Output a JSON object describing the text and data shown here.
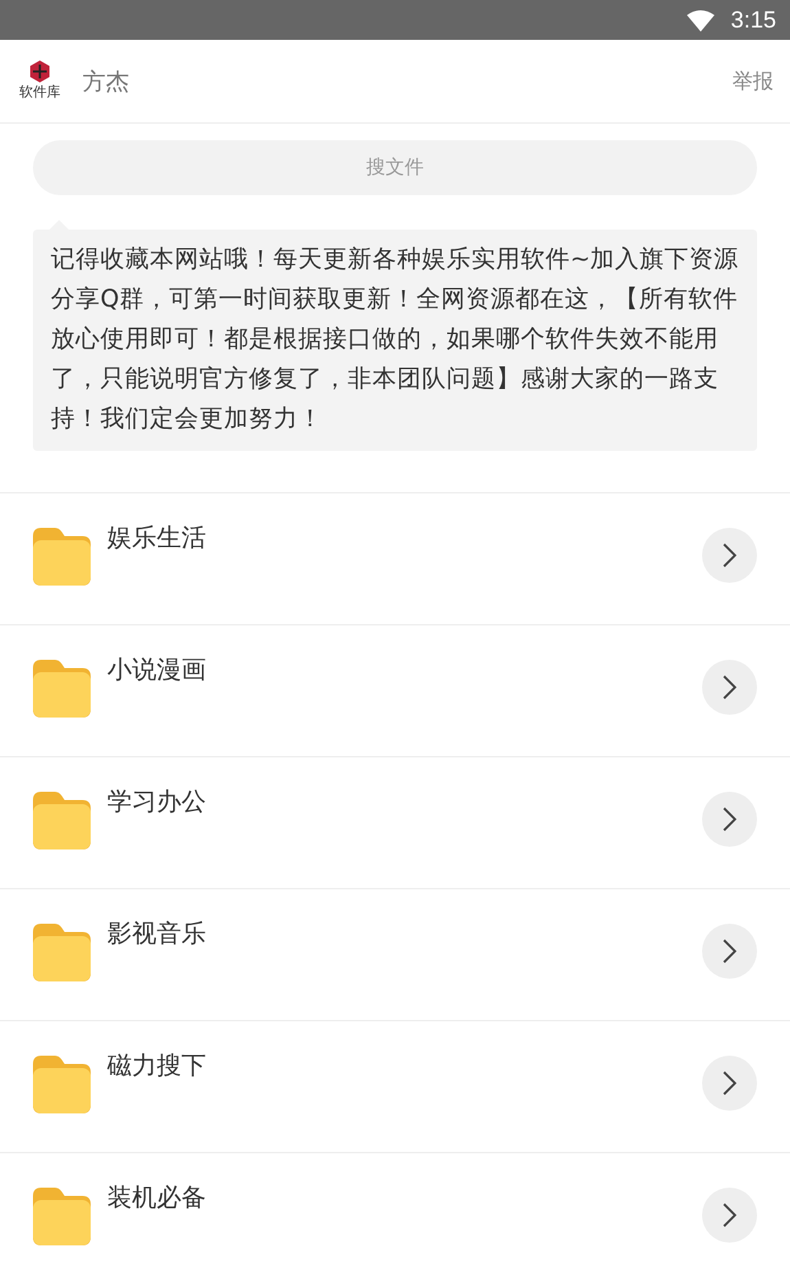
{
  "status_bar": {
    "time": "3:15"
  },
  "header": {
    "logo_text": "软件库",
    "title": "方杰",
    "action": "举报"
  },
  "search": {
    "placeholder": "搜文件"
  },
  "notice": "记得收藏本网站哦！每天更新各种娱乐实用软件~加入旗下资源分享Q群，可第一时间获取更新！全网资源都在这，【所有软件放心使用即可！都是根据接口做的，如果哪个软件失效不能用了，只能说明官方修复了，非本团队问题】感谢大家的一路支持！我们定会更加努力！",
  "folders": [
    {
      "name": "娱乐生活"
    },
    {
      "name": "小说漫画"
    },
    {
      "name": "学习办公"
    },
    {
      "name": "影视音乐"
    },
    {
      "name": "磁力搜下"
    },
    {
      "name": "装机必备"
    }
  ]
}
